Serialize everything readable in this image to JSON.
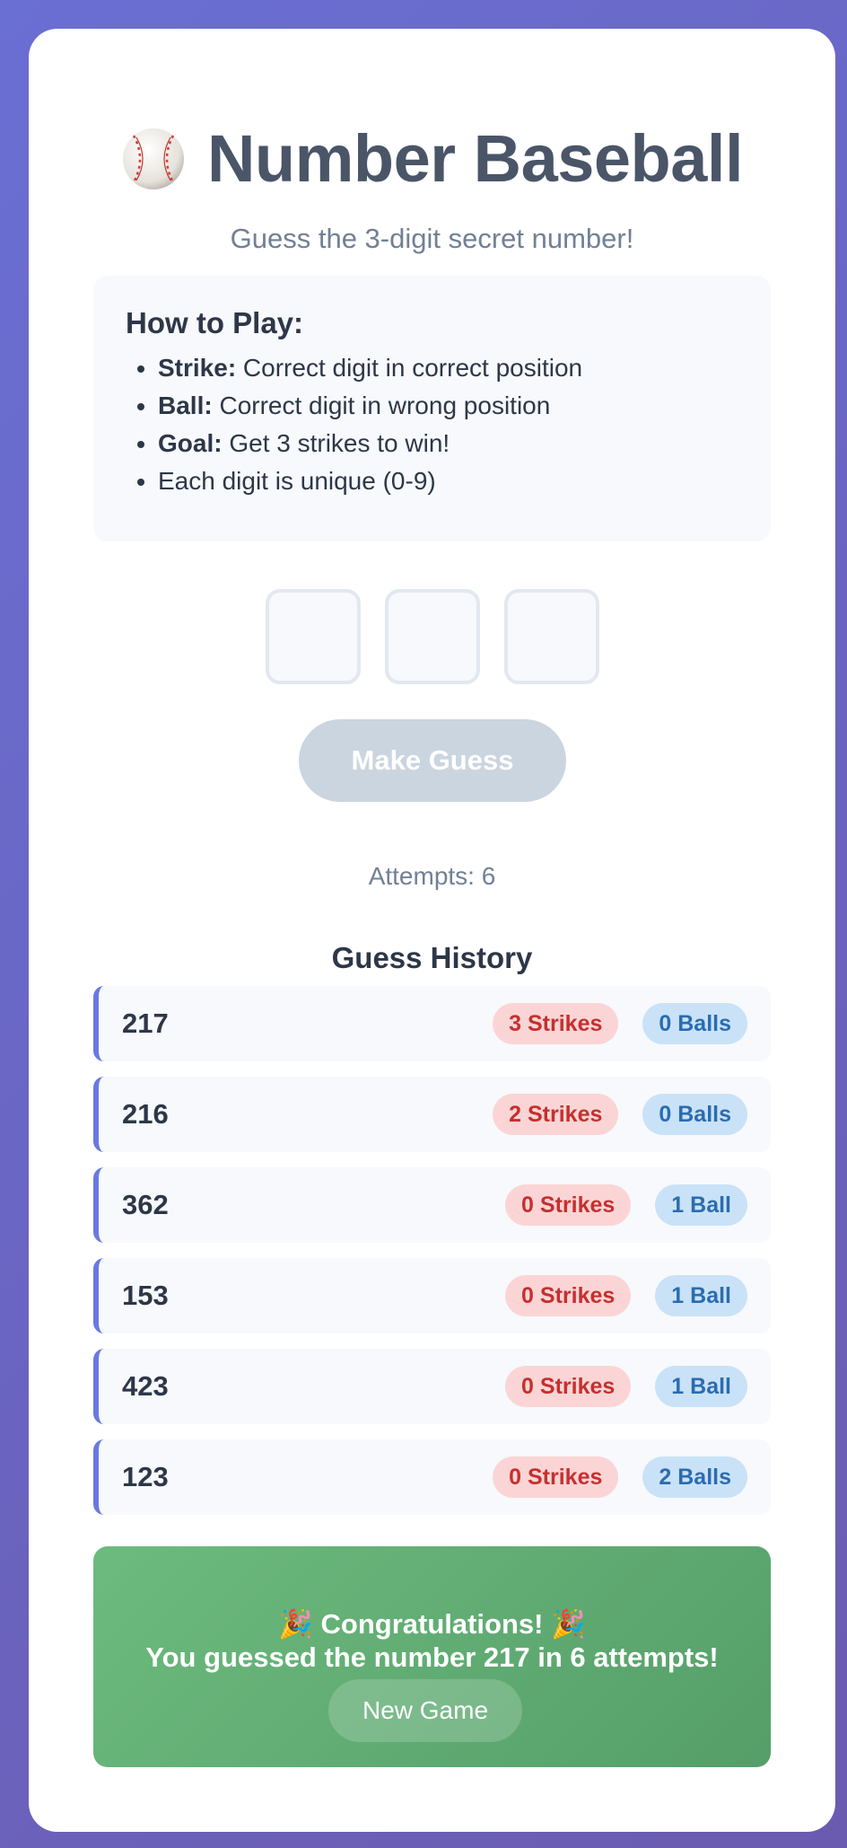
{
  "header": {
    "icon": "baseball-icon",
    "title": "Number Baseball",
    "subtitle": "Guess the 3-digit secret number!"
  },
  "how_to_play": {
    "heading": "How to Play:",
    "items": [
      {
        "label": "Strike:",
        "text": " Correct digit in correct position"
      },
      {
        "label": "Ball:",
        "text": " Correct digit in wrong position"
      },
      {
        "label": "Goal:",
        "text": " Get 3 strikes to win!"
      },
      {
        "label": "",
        "text": "Each digit is unique (0-9)"
      }
    ]
  },
  "input": {
    "digits": [
      "",
      "",
      ""
    ],
    "button_label": "Make Guess",
    "button_disabled": true
  },
  "attempts_text": "Attempts: 6",
  "history": {
    "title": "Guess History",
    "rows": [
      {
        "guess": "217",
        "strikes": "3 Strikes",
        "balls": "0 Balls"
      },
      {
        "guess": "216",
        "strikes": "2 Strikes",
        "balls": "0 Balls"
      },
      {
        "guess": "362",
        "strikes": "0 Strikes",
        "balls": "1 Ball"
      },
      {
        "guess": "153",
        "strikes": "0 Strikes",
        "balls": "1 Ball"
      },
      {
        "guess": "423",
        "strikes": "0 Strikes",
        "balls": "1 Ball"
      },
      {
        "guess": "123",
        "strikes": "0 Strikes",
        "balls": "2 Balls"
      }
    ]
  },
  "win": {
    "line1": "🎉 Congratulations! 🎉",
    "line2": "You guessed the number 217 in 6 attempts!",
    "button_label": "New Game"
  },
  "colors": {
    "accent": "#6b79e0",
    "success": "#5fae73",
    "strike_text": "#c53030",
    "ball_text": "#2b6cb0"
  }
}
